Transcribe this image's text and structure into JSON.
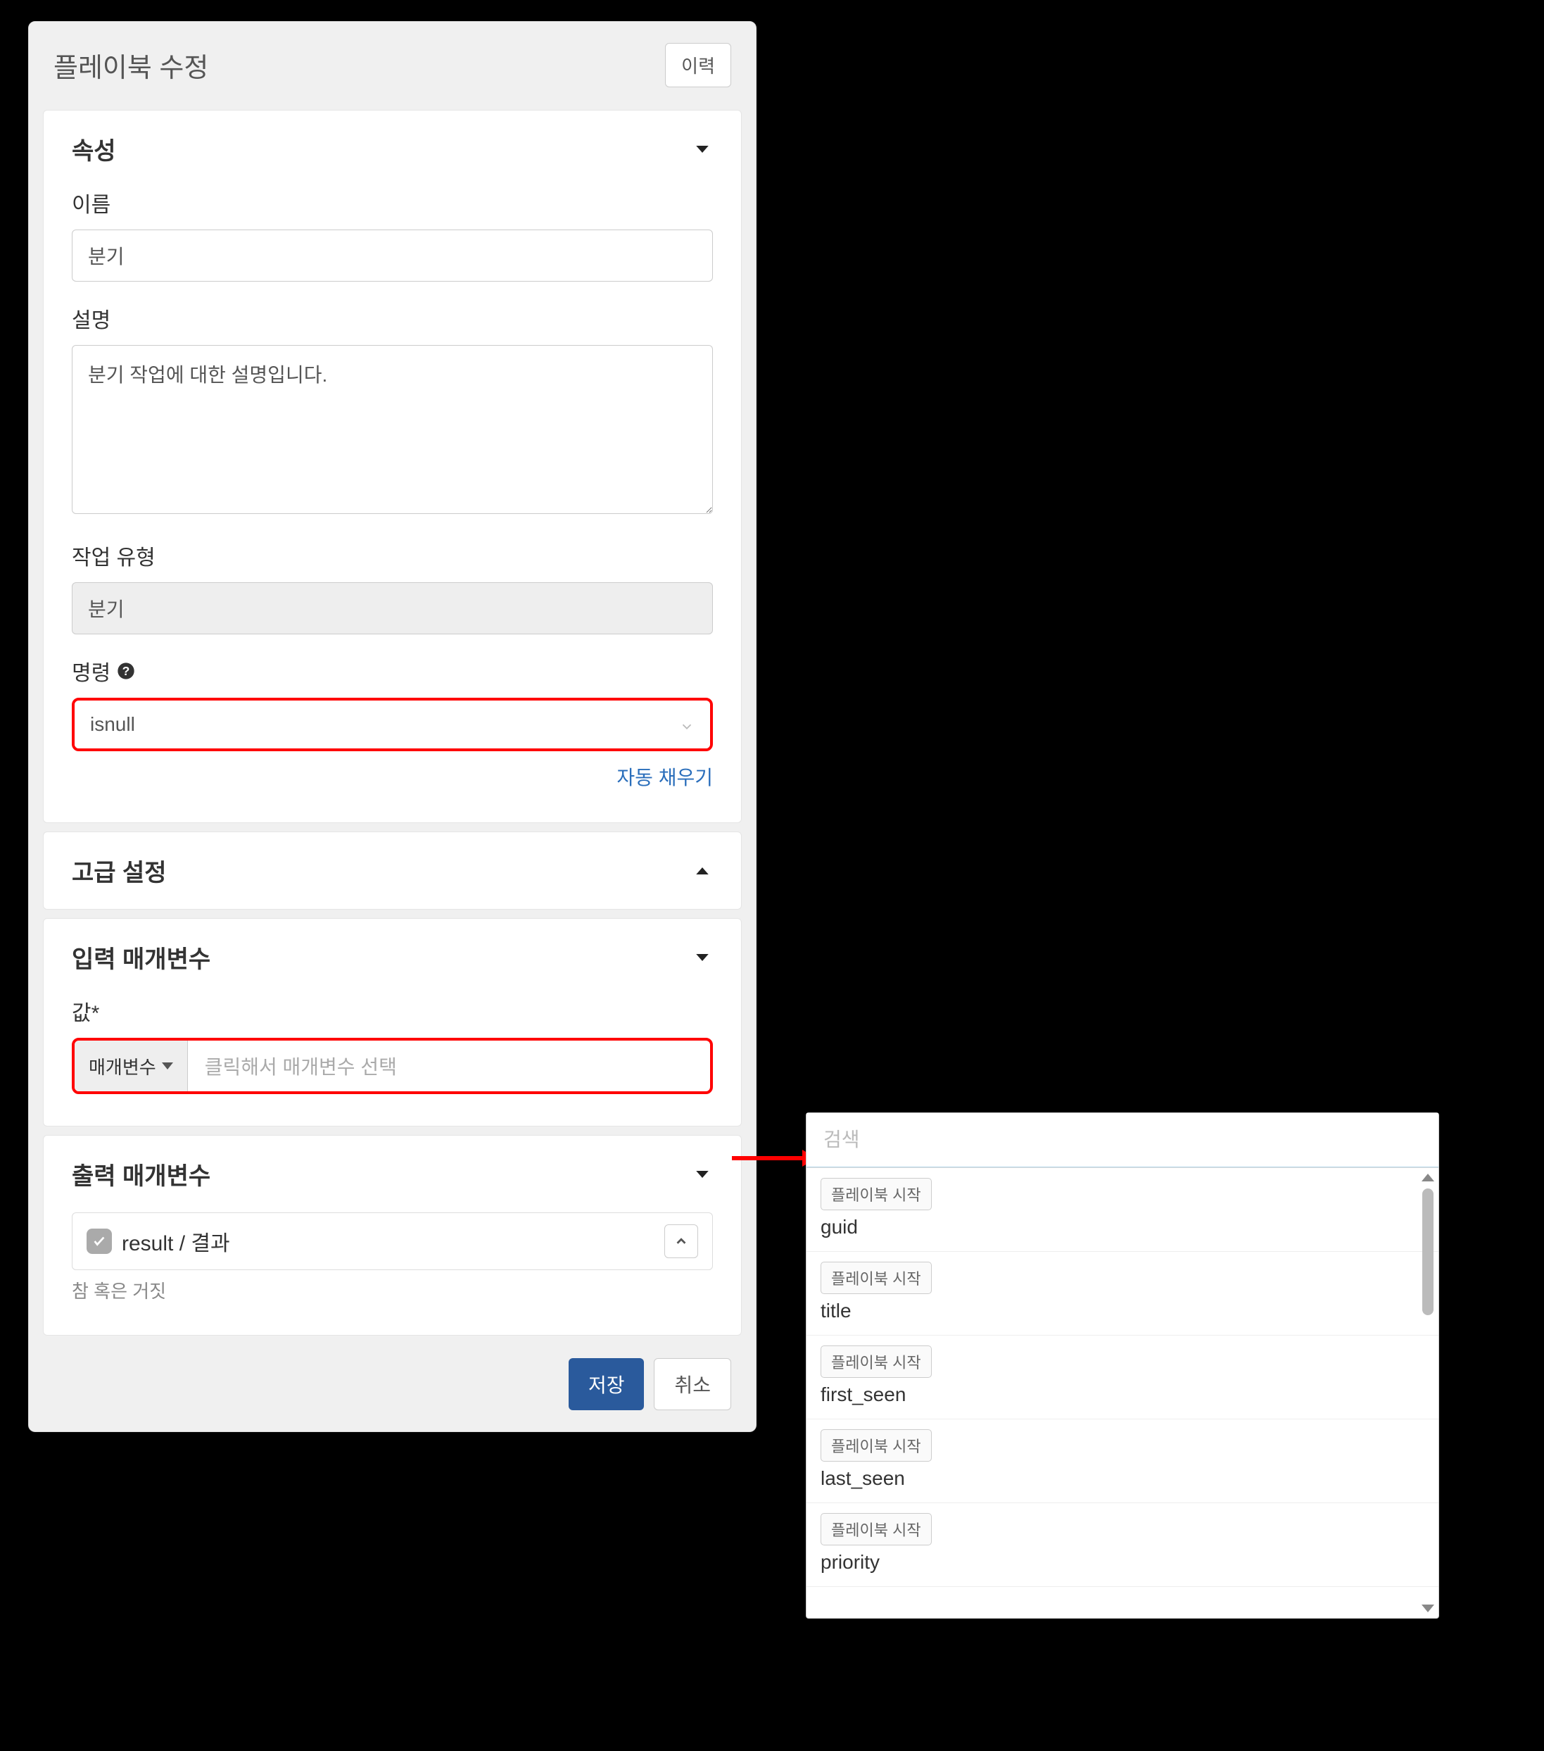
{
  "panel": {
    "title": "플레이북 수정",
    "history_btn": "이력"
  },
  "sections": {
    "attributes": {
      "title": "속성",
      "name_label": "이름",
      "name_value": "분기",
      "desc_label": "설명",
      "desc_value": "분기 작업에 대한 설명입니다.",
      "type_label": "작업 유형",
      "type_value": "분기",
      "command_label": "명령",
      "command_value": "isnull",
      "autofill_link": "자동 채우기"
    },
    "advanced": {
      "title": "고급 설정"
    },
    "input_params": {
      "title": "입력 매개변수",
      "value_label": "값*",
      "param_type": "매개변수",
      "param_placeholder": "클릭해서 매개변수 선택"
    },
    "output_params": {
      "title": "출력 매개변수",
      "result_name": "result / 결과",
      "result_desc": "참 혹은 거짓"
    }
  },
  "footer": {
    "save": "저장",
    "cancel": "취소"
  },
  "popup": {
    "search_placeholder": "검색",
    "items": [
      {
        "badge": "플레이북 시작",
        "name": "guid"
      },
      {
        "badge": "플레이북 시작",
        "name": "title"
      },
      {
        "badge": "플레이북 시작",
        "name": "first_seen"
      },
      {
        "badge": "플레이북 시작",
        "name": "last_seen"
      },
      {
        "badge": "플레이북 시작",
        "name": "priority"
      }
    ]
  }
}
